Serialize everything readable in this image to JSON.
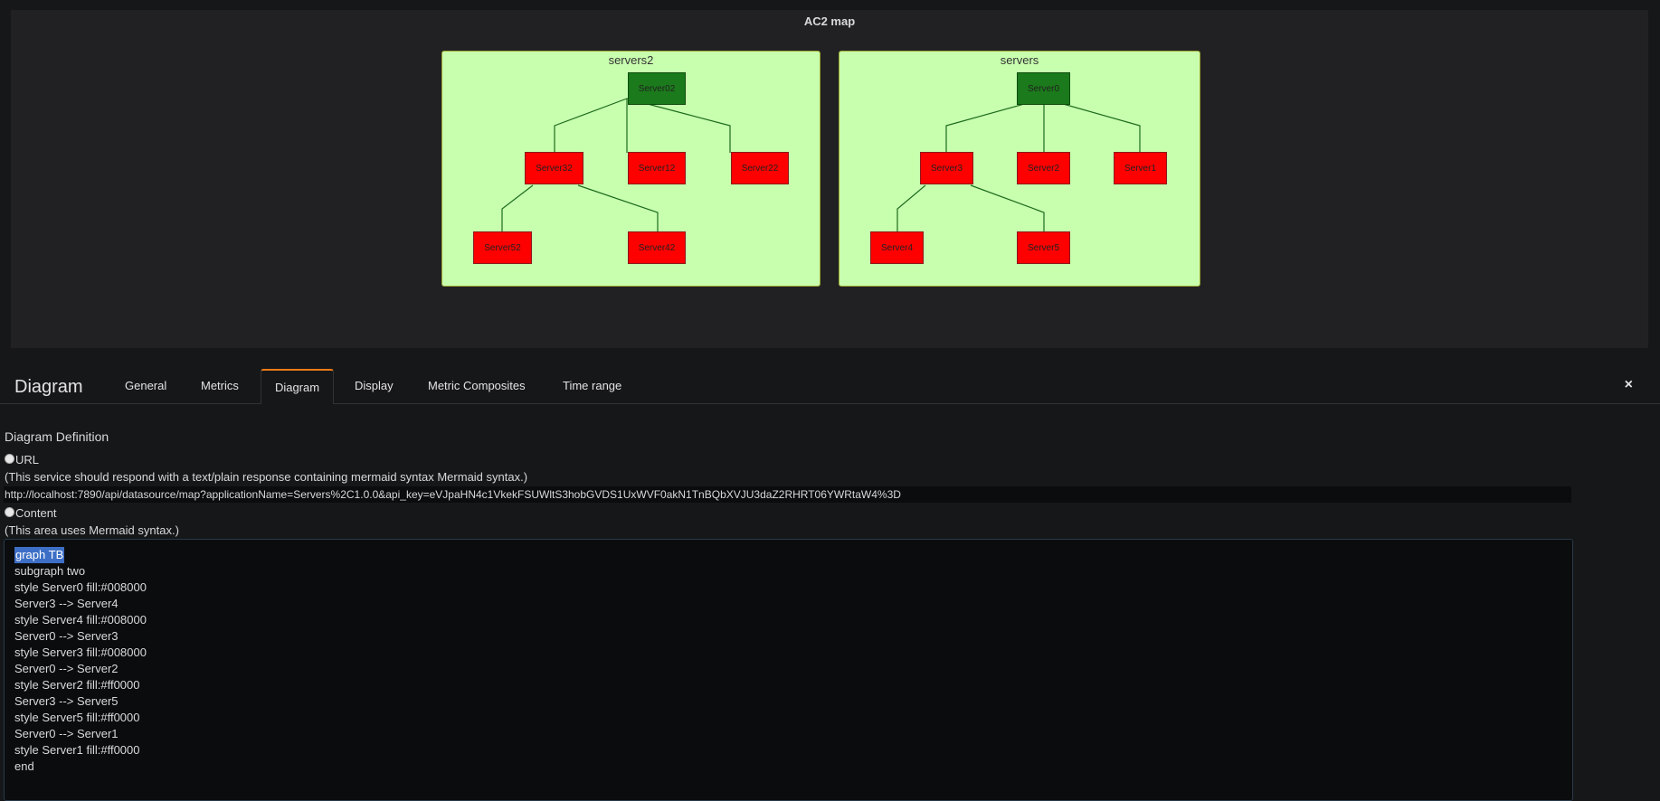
{
  "panel": {
    "title": "AC2 map",
    "clusters": [
      {
        "label": "servers2",
        "nodes": [
          {
            "id": "Server02",
            "fill": "#008000"
          },
          {
            "id": "Server32",
            "fill": "#ff0000"
          },
          {
            "id": "Server12",
            "fill": "#ff0000"
          },
          {
            "id": "Server22",
            "fill": "#ff0000"
          },
          {
            "id": "Server52",
            "fill": "#ff0000"
          },
          {
            "id": "Server42",
            "fill": "#ff0000"
          }
        ]
      },
      {
        "label": "servers",
        "nodes": [
          {
            "id": "Server0",
            "fill": "#008000"
          },
          {
            "id": "Server3",
            "fill": "#ff0000"
          },
          {
            "id": "Server2",
            "fill": "#ff0000"
          },
          {
            "id": "Server1",
            "fill": "#ff0000"
          },
          {
            "id": "Server4",
            "fill": "#ff0000"
          },
          {
            "id": "Server5",
            "fill": "#ff0000"
          }
        ]
      }
    ]
  },
  "editor": {
    "title": "Diagram",
    "tabs": [
      "General",
      "Metrics",
      "Diagram",
      "Display",
      "Metric Composites",
      "Time range"
    ],
    "active_tab": "Diagram",
    "close_icon": "×",
    "section_title": "Diagram Definition",
    "url_option": "URL",
    "url_hint": "(This service should respond with a text/plain response containing mermaid syntax Mermaid syntax.)",
    "url_value": "http://localhost:7890/api/datasource/map?applicationName=Servers%2C1.0.0&api_key=eVJpaHN4c1VkekFSUWltS3hobGVDS1UxWVF0akN1TnBQbXVJU3daZ2RHRT06YWRtaW4%3D",
    "content_option": "Content",
    "content_hint": "(This area uses Mermaid syntax.)",
    "content_lines": [
      "graph TB",
      "subgraph two",
      "style Server0 fill:#008000",
      "Server3 --> Server4",
      "style Server4 fill:#008000",
      "Server0 --> Server3",
      "style Server3 fill:#008000",
      "Server0 --> Server2",
      "style Server2 fill:#ff0000",
      "Server3 --> Server5",
      "style Server5 fill:#ff0000",
      "Server0 --> Server1",
      "style Server1 fill:#ff0000",
      "end"
    ]
  },
  "colors": {
    "green_node": "#1b7a1b",
    "red_node": "#ff0000",
    "cluster_bg": "#c8ffaf",
    "active_tab_accent": "#eb7b18"
  }
}
